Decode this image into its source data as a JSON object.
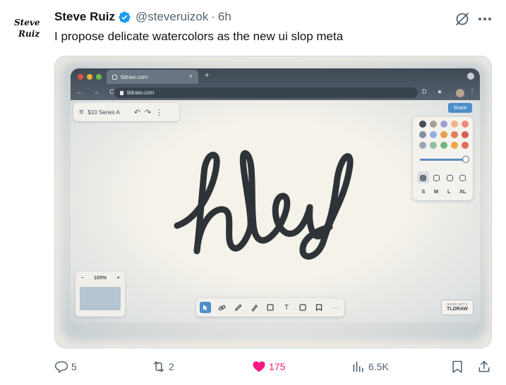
{
  "tweet": {
    "author_name": "Steve Ruiz",
    "handle": "@steveruizok",
    "separator": "·",
    "time": "6h",
    "text": "I propose delicate watercolors as the new ui slop meta",
    "avatar_text": [
      "Steve",
      "Ruiz"
    ]
  },
  "media": {
    "browser": {
      "tab_title": "tldraw.com",
      "tab_close": "×",
      "new_tab": "+",
      "nav": "← → C",
      "url": "tldraw.com",
      "url_icons": "D ★"
    },
    "app": {
      "document_title": "$10 Series A",
      "share_label": "Share",
      "palette": [
        "#454e57",
        "#a6a19a",
        "#9a9fd3",
        "#f2b38a",
        "#ef8a7a",
        "#7d8fa5",
        "#8cb0e0",
        "#e9a24a",
        "#e47c5d",
        "#d65e4f",
        "#9aa7b2",
        "#8fc0a0",
        "#6fb57d",
        "#f0a645",
        "#e36a55"
      ],
      "opacity": 1,
      "sizes": [
        "S",
        "M",
        "L",
        "XL"
      ],
      "zoom_minus": "−",
      "zoom_level": "100%",
      "zoom_plus": "+",
      "tool_text": "T",
      "tool_more": "···",
      "drawing_text": "Hey",
      "made_with_top": "MADE WITH",
      "made_with_brand": "TLDRAW"
    }
  },
  "actions": {
    "replies": "5",
    "reposts": "2",
    "likes": "175",
    "views": "6.5K"
  },
  "colors": {
    "like": "#f91880",
    "verified": "#1d9bf0",
    "secondary_text": "#536471",
    "accent_blue": "#4d8ecb"
  }
}
